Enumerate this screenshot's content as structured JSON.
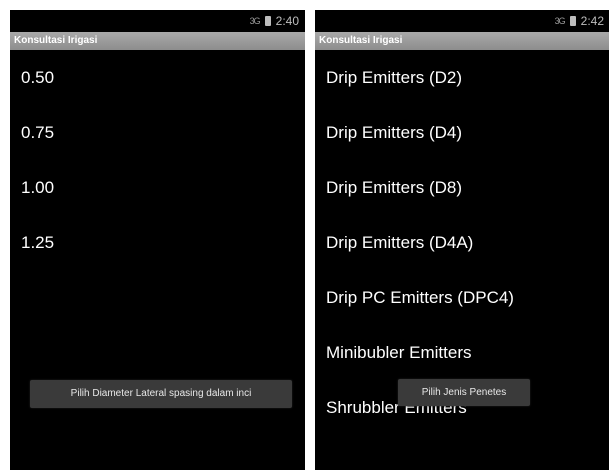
{
  "left": {
    "status": {
      "time": "2:40",
      "signal": "3G"
    },
    "title": "Konsultasi Irigasi",
    "items": [
      "0.50",
      "0.75",
      "1.00",
      "1.25"
    ],
    "toast": "Pilih Diameter Lateral spasing dalam inci"
  },
  "right": {
    "status": {
      "time": "2:42",
      "signal": "3G"
    },
    "title": "Konsultasi Irigasi",
    "items": [
      "Drip Emitters (D2)",
      "Drip Emitters (D4)",
      "Drip Emitters (D8)",
      "Drip Emitters (D4A)",
      "Drip PC Emitters (DPC4)",
      "Minibubler Emitters",
      "Shrubbler Emitters"
    ],
    "toast": "Pilih Jenis Penetes"
  },
  "colors": {
    "background": "#000000",
    "title_bar": "#9a9a9a",
    "text": "#ffffff",
    "toast": "#3a3a3a"
  }
}
